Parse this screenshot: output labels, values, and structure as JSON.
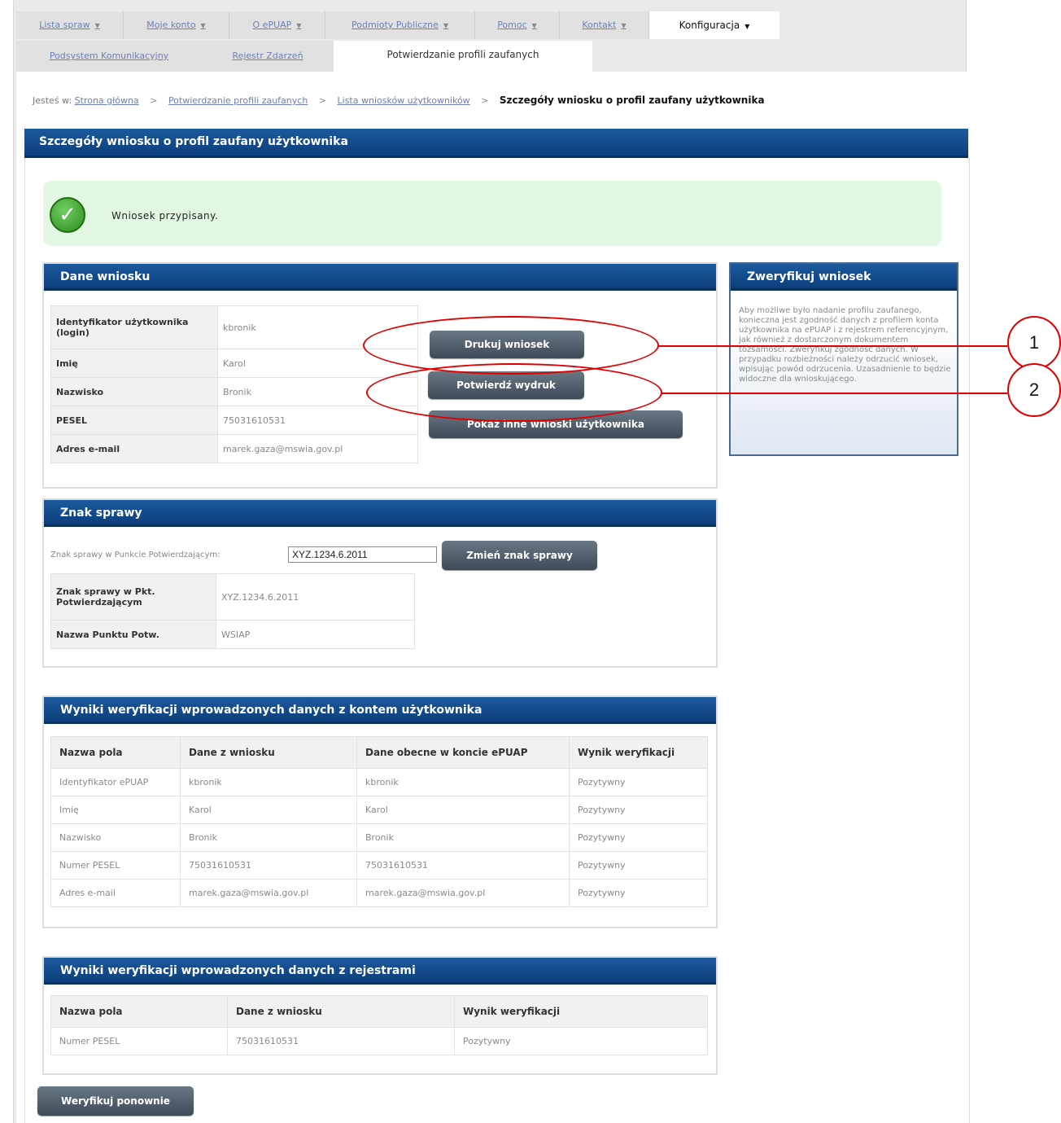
{
  "nav": {
    "tabs": [
      {
        "label": "Lista spraw"
      },
      {
        "label": "Moje konto"
      },
      {
        "label": "O ePUAP"
      },
      {
        "label": "Podmioty Publiczne"
      },
      {
        "label": "Pomoc"
      },
      {
        "label": "Kontakt"
      },
      {
        "label": "Konfiguracja"
      }
    ],
    "subtabs": [
      {
        "label": "Podsystem Komunikacyjny"
      },
      {
        "label": "Rejestr Zdarzeń"
      },
      {
        "label": "Potwierdzanie profili zaufanych"
      }
    ]
  },
  "breadcrumb": {
    "prefix": "Jesteś w:",
    "items": [
      "Strona główna",
      "Potwierdzanie profili zaufanych",
      "Lista wniosków użytkowników"
    ],
    "current": "Szczegóły wniosku o profil zaufany użytkownika",
    "separator": ">"
  },
  "page": {
    "title": "Szczegóły wniosku o profil zaufany użytkownika"
  },
  "alert": {
    "message": "Wniosek przypisany."
  },
  "application": {
    "title": "Dane wniosku",
    "rows": [
      {
        "label": "Identyfikator użytkownika (login)",
        "value": "kbronik"
      },
      {
        "label": "Imię",
        "value": "Karol"
      },
      {
        "label": "Nazwisko",
        "value": "Bronik"
      },
      {
        "label": "PESEL",
        "value": "75031610531"
      },
      {
        "label": "Adres e-mail",
        "value": "marek.gaza@mswia.gov.pl"
      }
    ],
    "buttons": {
      "print": "Drukuj wniosek",
      "confirm": "Potwierdź wydruk",
      "other": "Pokaż inne wnioski użytkownika"
    }
  },
  "sidebar": {
    "title": "Zweryfikuj wniosek",
    "text": "Aby możliwe było nadanie profilu zaufanego, konieczna jest zgodność danych z profilem konta użytkownika na ePUAP i z rejestrem referencyjnym, jak również z dostarczonym dokumentem tożsamości. Zweryfikuj zgodność danych. W przypadku rozbieżności należy odrzucić wniosek, wpisując powód odrzucenia. Uzasadnienie to będzie widoczne dla wnioskującego."
  },
  "case": {
    "title": "Znak sprawy",
    "input_label": "Znak sprawy w Punkcie Potwierdzającym:",
    "input_value": "XYZ.1234.6.2011",
    "button": "Zmień znak sprawy",
    "rows": [
      {
        "label": "Znak sprawy w Pkt. Potwierdzającym",
        "value": "XYZ.1234.6.2011"
      },
      {
        "label": "Nazwa Punktu Potw.",
        "value": "WSIAP"
      }
    ]
  },
  "verify_account": {
    "title": "Wyniki weryfikacji wprowadzonych danych z kontem użytkownika",
    "headers": [
      "Nazwa pola",
      "Dane z wniosku",
      "Dane obecne w koncie ePUAP",
      "Wynik weryfikacji"
    ],
    "rows": [
      [
        "Identyfikator ePUAP",
        "kbronik",
        "kbronik",
        "Pozytywny"
      ],
      [
        "Imię",
        "Karol",
        "Karol",
        "Pozytywny"
      ],
      [
        "Nazwisko",
        "Bronik",
        "Bronik",
        "Pozytywny"
      ],
      [
        "Numer PESEL",
        "75031610531",
        "75031610531",
        "Pozytywny"
      ],
      [
        "Adres e-mail",
        "marek.gaza@mswia.gov.pl",
        "marek.gaza@mswia.gov.pl",
        "Pozytywny"
      ]
    ]
  },
  "verify_registry": {
    "title": "Wyniki weryfikacji wprowadzonych danych z rejestrami",
    "headers": [
      "Nazwa pola",
      "Dane z wniosku",
      "Wynik weryfikacji"
    ],
    "rows": [
      [
        "Numer PESEL",
        "75031610531",
        "Pozytywny"
      ]
    ]
  },
  "reverify_button": "Weryfikuj ponownie",
  "annotations": {
    "one": "1",
    "two": "2"
  },
  "colors": {
    "header_bar": "#0c3e7b",
    "success_bg": "#e2f8e2",
    "callout": "#e00000",
    "button": "#4a5663"
  }
}
